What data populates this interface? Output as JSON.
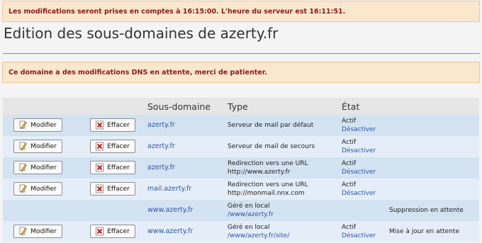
{
  "alerts": {
    "schedule": "Les modifications seront prises en comptes à 16:15:00. L'heure du serveur est 16:11:51.",
    "pending": "Ce domaine a des modifications DNS en attente, merci de patienter."
  },
  "page_title": "Edition des sous-domaines de azerty.fr",
  "table": {
    "headers": [
      "",
      "",
      "Sous-domaine",
      "Type",
      "État",
      ""
    ],
    "modify_label": "Modifier",
    "delete_label": "Effacer",
    "rows": [
      {
        "subdomain": "azerty.fr",
        "type_line1": "Serveur de mail par défaut",
        "type_line2": "",
        "state": "Actif",
        "toggle": "Désactiver",
        "note": "",
        "actions": true
      },
      {
        "subdomain": "azerty.fr",
        "type_line1": "Serveur de mail de secours",
        "type_line2": "",
        "state": "Actif",
        "toggle": "Désactiver",
        "note": "",
        "actions": true
      },
      {
        "subdomain": "azerty.fr",
        "type_line1": "Redirection vers une URL",
        "type_line2": "http://www.azerty.fr",
        "state": "Actif",
        "toggle": "Désactiver",
        "note": "",
        "actions": true
      },
      {
        "subdomain": "mail.azerty.fr",
        "type_line1": "Redirection vers une URL",
        "type_line2": "http://monmail.nnx.com",
        "state": "Actif",
        "toggle": "Désactiver",
        "note": "",
        "actions": true
      },
      {
        "subdomain": "www.azerty.fr",
        "type_line1": "Géré en local",
        "type_line2": "/www/azerty.fr",
        "state": "",
        "toggle": "",
        "note": "Suppression en attente",
        "actions": false
      },
      {
        "subdomain": "www.azerty.fr",
        "type_line1": "Géré en local",
        "type_line2": "/www/azerty.fr/site/",
        "state": "Actif",
        "toggle": "Désactiver",
        "note": "Mise à jour en attente",
        "actions": true
      }
    ]
  },
  "colors": {
    "alert_bg": "#fbe7cc",
    "alert_text": "#8b1a1a",
    "row_odd": "#d3e3f2",
    "row_even": "#e5eef8",
    "link": "#2c54a8"
  },
  "icons": {
    "modify": "pencil-icon",
    "delete": "delete-x-icon"
  }
}
